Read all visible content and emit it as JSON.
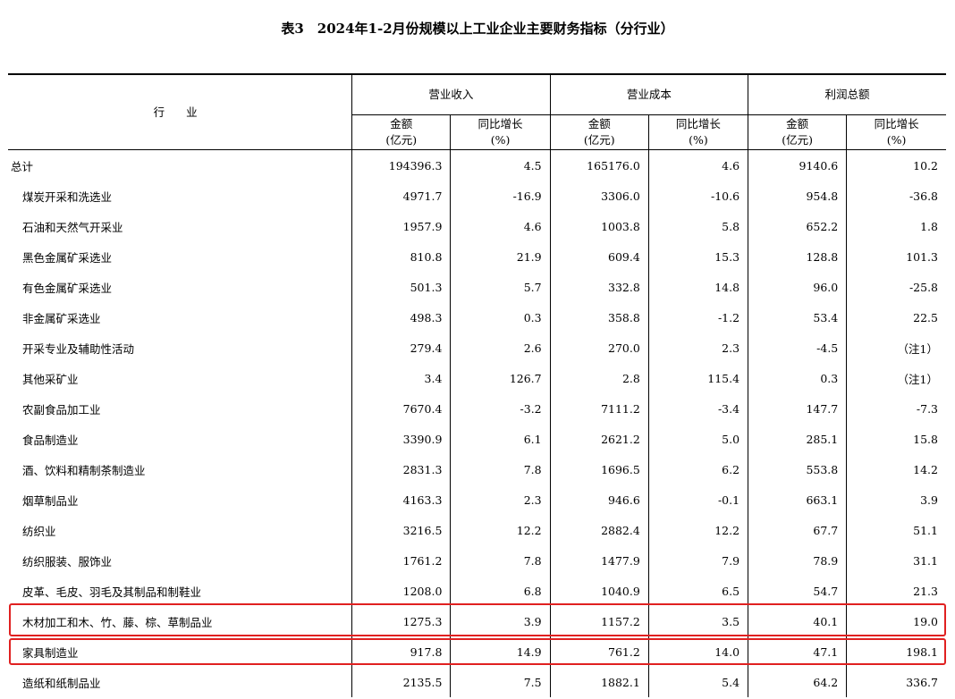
{
  "title": "表3　2024年1-2月份规模以上工业企业主要财务指标（分行业）",
  "header": {
    "industry": "行 业",
    "groups": [
      "营业收入",
      "营业成本",
      "利润总额"
    ],
    "amount_label": "金额",
    "amount_unit": "(亿元)",
    "growth_label": "同比增长",
    "growth_unit": "(%)"
  },
  "rows": [
    {
      "name": "总计",
      "v": [
        "194396.3",
        "4.5",
        "165176.0",
        "4.6",
        "9140.6",
        "10.2"
      ]
    },
    {
      "name": "煤炭开采和洗选业",
      "v": [
        "4971.7",
        "-16.9",
        "3306.0",
        "-10.6",
        "954.8",
        "-36.8"
      ]
    },
    {
      "name": "石油和天然气开采业",
      "v": [
        "1957.9",
        "4.6",
        "1003.8",
        "5.8",
        "652.2",
        "1.8"
      ]
    },
    {
      "name": "黑色金属矿采选业",
      "v": [
        "810.8",
        "21.9",
        "609.4",
        "15.3",
        "128.8",
        "101.3"
      ]
    },
    {
      "name": "有色金属矿采选业",
      "v": [
        "501.3",
        "5.7",
        "332.8",
        "14.8",
        "96.0",
        "-25.8"
      ]
    },
    {
      "name": "非金属矿采选业",
      "v": [
        "498.3",
        "0.3",
        "358.8",
        "-1.2",
        "53.4",
        "22.5"
      ]
    },
    {
      "name": "开采专业及辅助性活动",
      "v": [
        "279.4",
        "2.6",
        "270.0",
        "2.3",
        "-4.5",
        "（注1）"
      ]
    },
    {
      "name": "其他采矿业",
      "v": [
        "3.4",
        "126.7",
        "2.8",
        "115.4",
        "0.3",
        "（注1）"
      ]
    },
    {
      "name": "农副食品加工业",
      "v": [
        "7670.4",
        "-3.2",
        "7111.2",
        "-3.4",
        "147.7",
        "-7.3"
      ]
    },
    {
      "name": "食品制造业",
      "v": [
        "3390.9",
        "6.1",
        "2621.2",
        "5.0",
        "285.1",
        "15.8"
      ]
    },
    {
      "name": "酒、饮料和精制茶制造业",
      "v": [
        "2831.3",
        "7.8",
        "1696.5",
        "6.2",
        "553.8",
        "14.2"
      ]
    },
    {
      "name": "烟草制品业",
      "v": [
        "4163.3",
        "2.3",
        "946.6",
        "-0.1",
        "663.1",
        "3.9"
      ]
    },
    {
      "name": "纺织业",
      "v": [
        "3216.5",
        "12.2",
        "2882.4",
        "12.2",
        "67.7",
        "51.1"
      ]
    },
    {
      "name": "纺织服装、服饰业",
      "v": [
        "1761.2",
        "7.8",
        "1477.9",
        "7.9",
        "78.9",
        "31.1"
      ]
    },
    {
      "name": "皮革、毛皮、羽毛及其制品和制鞋业",
      "v": [
        "1208.0",
        "6.8",
        "1040.9",
        "6.5",
        "54.7",
        "21.3"
      ]
    },
    {
      "name": "木材加工和木、竹、藤、棕、草制品业",
      "v": [
        "1275.3",
        "3.9",
        "1157.2",
        "3.5",
        "40.1",
        "19.0"
      ]
    },
    {
      "name": "家具制造业",
      "v": [
        "917.8",
        "14.9",
        "761.2",
        "14.0",
        "47.1",
        "198.1"
      ]
    },
    {
      "name": "造纸和纸制品业",
      "v": [
        "2135.5",
        "7.5",
        "1882.1",
        "5.4",
        "64.2",
        "336.7"
      ]
    }
  ],
  "highlight_color": "#e02020"
}
